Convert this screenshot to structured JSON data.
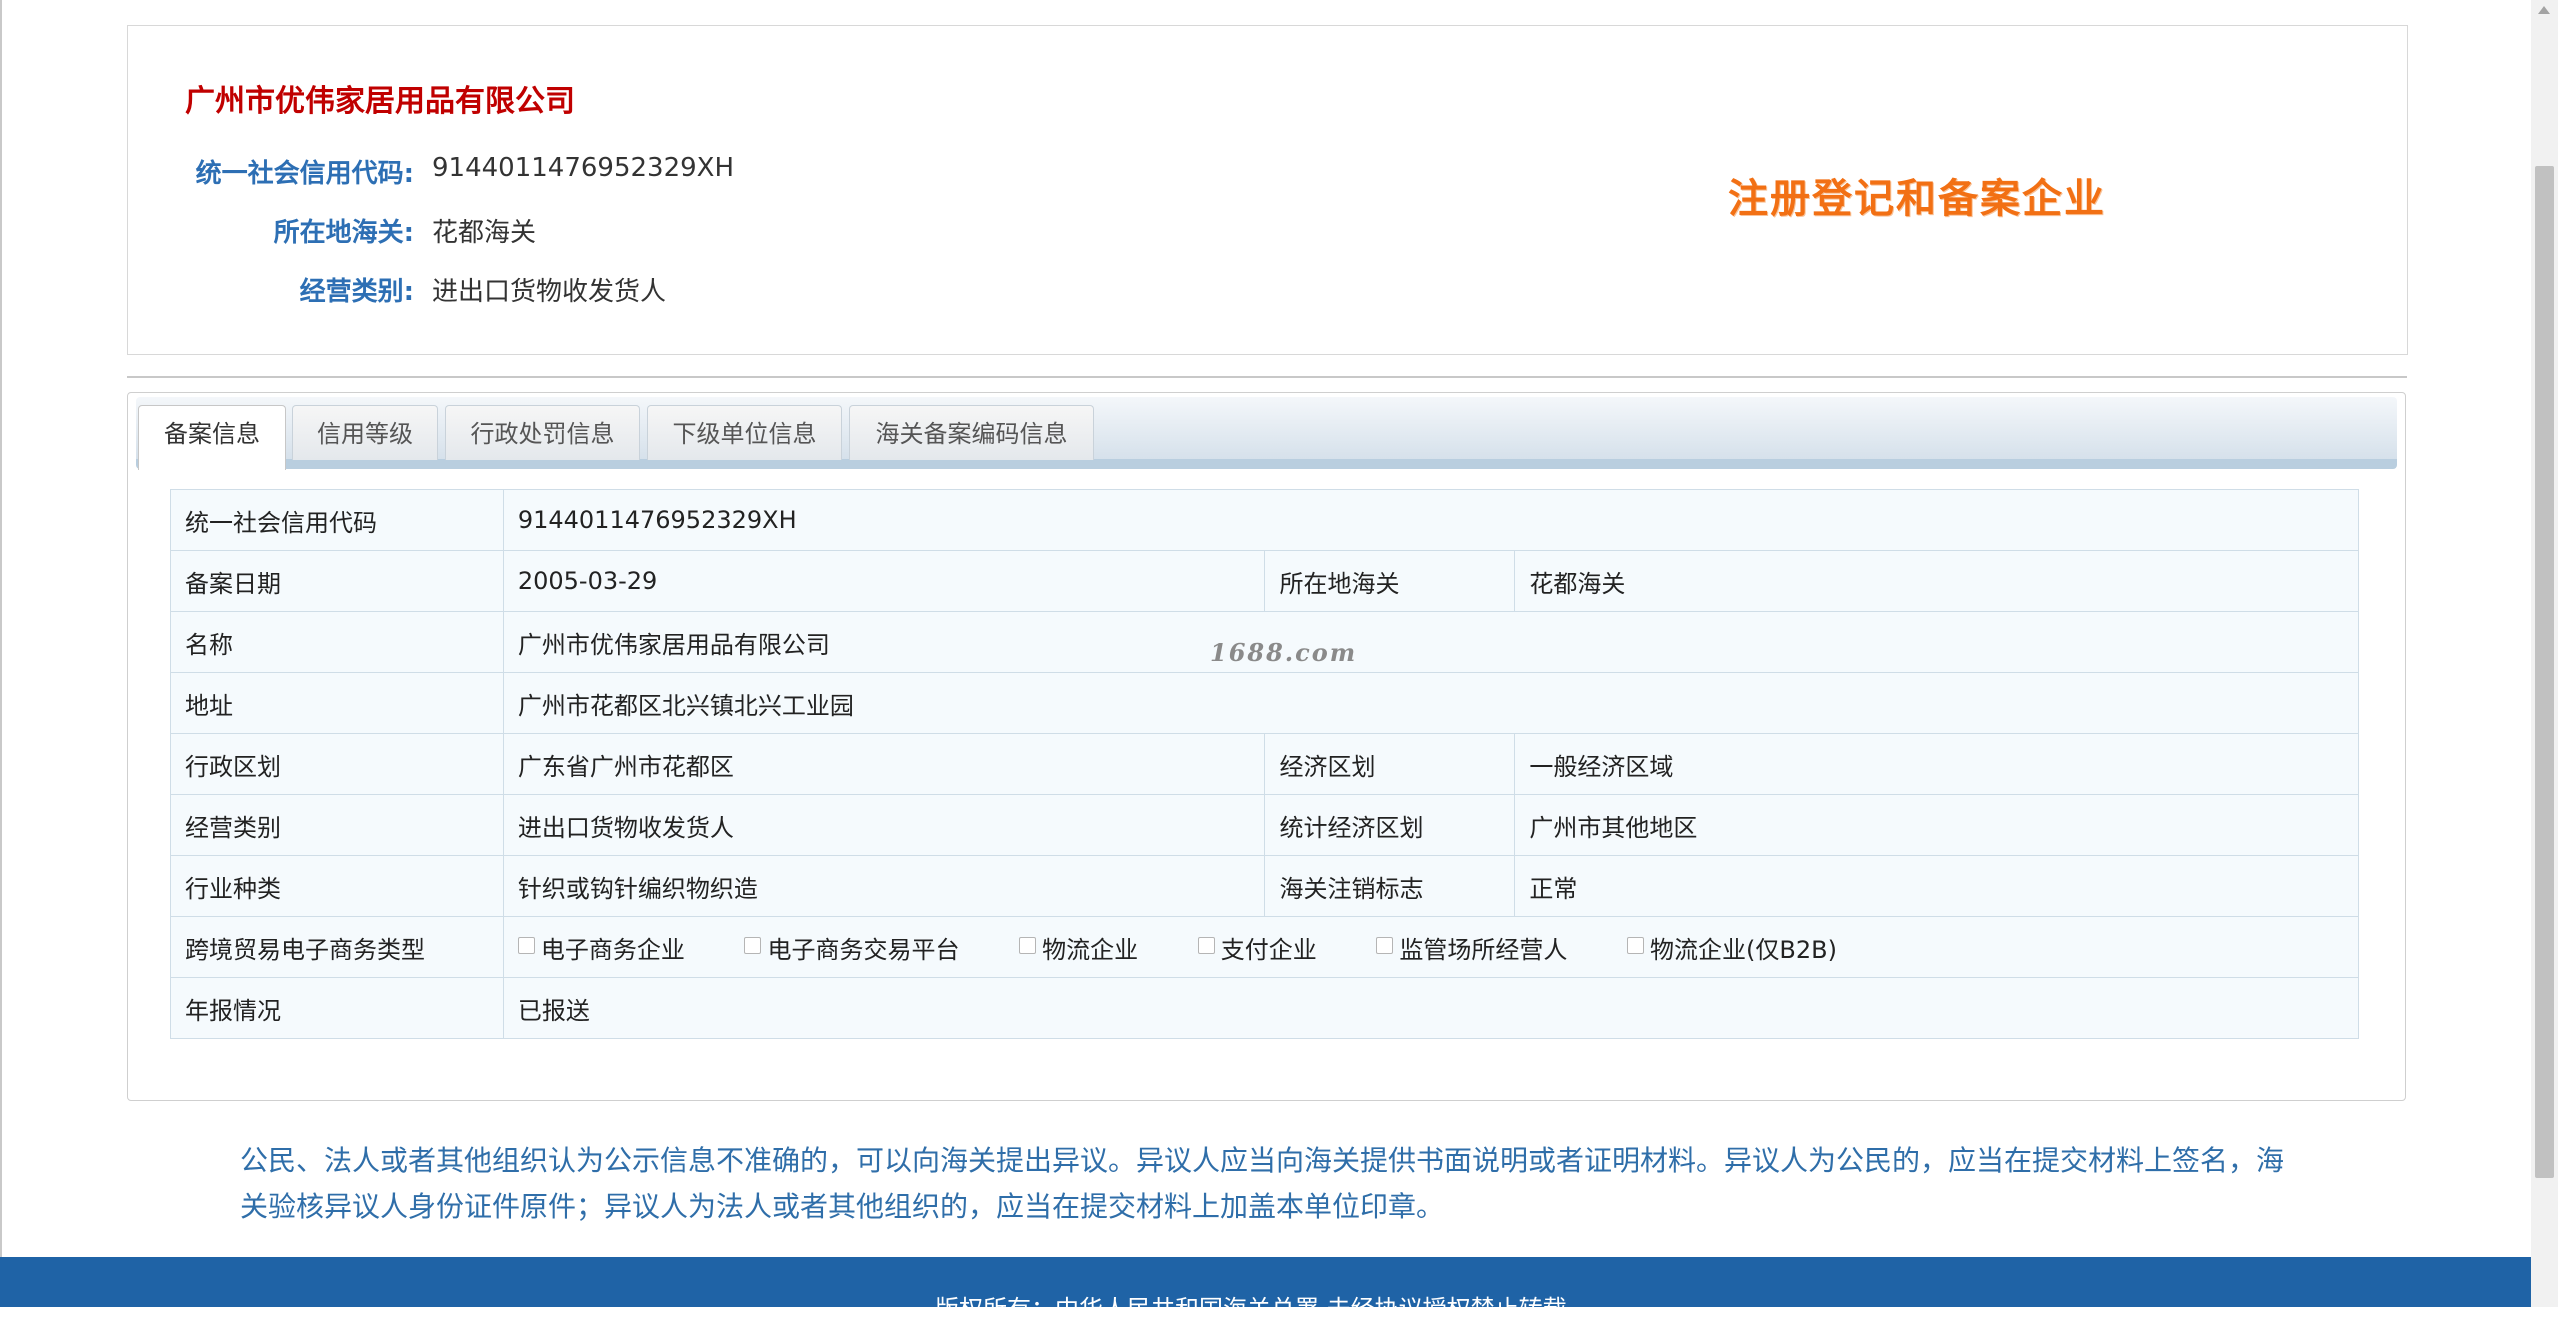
{
  "company": {
    "name": "广州市优伟家居用品有限公司",
    "fields": [
      {
        "label": "统一社会信用代码:",
        "value": "9144011476952329XH"
      },
      {
        "label": "所在地海关:",
        "value": "花都海关"
      },
      {
        "label": "经营类别:",
        "value": "进出口货物收发货人"
      }
    ],
    "stamp": "注册登记和备案企业"
  },
  "tabs": [
    {
      "label": "备案信息",
      "active": true
    },
    {
      "label": "信用等级",
      "active": false
    },
    {
      "label": "行政处罚信息",
      "active": false
    },
    {
      "label": "下级单位信息",
      "active": false
    },
    {
      "label": "海关备案编码信息",
      "active": false
    }
  ],
  "details": {
    "credit_code": {
      "label": "统一社会信用代码",
      "value": "9144011476952329XH"
    },
    "record_date": {
      "label": "备案日期",
      "value": "2005-03-29"
    },
    "customs": {
      "label": "所在地海关",
      "value": "花都海关"
    },
    "name": {
      "label": "名称",
      "value": "广州市优伟家居用品有限公司"
    },
    "address": {
      "label": "地址",
      "value": "广州市花都区北兴镇北兴工业园"
    },
    "admin_region": {
      "label": "行政区划",
      "value": "广东省广州市花都区"
    },
    "econ_region": {
      "label": "经济区划",
      "value": "一般经济区域"
    },
    "business_type": {
      "label": "经营类别",
      "value": "进出口货物收发货人"
    },
    "stat_region": {
      "label": "统计经济区划",
      "value": "广州市其他地区"
    },
    "industry": {
      "label": "行业种类",
      "value": "针织或钩针编织物织造"
    },
    "cancel_flag": {
      "label": "海关注销标志",
      "value": "正常"
    },
    "ecommerce": {
      "label": "跨境贸易电子商务类型",
      "options": [
        "电子商务企业",
        "电子商务交易平台",
        "物流企业",
        "支付企业",
        "监管场所经营人",
        "物流企业(仅B2B)"
      ]
    },
    "annual_report": {
      "label": "年报情况",
      "value": "已报送"
    }
  },
  "watermark": "1688.com",
  "notice": "公民、法人或者其他组织认为公示信息不准确的，可以向海关提出异议。异议人应当向海关提供书面说明或者证明材料。异议人为公民的，应当在提交材料上签名，海关验核异议人身份证件原件；异议人为法人或者其他组织的，应当在提交材料上加盖本单位印章。",
  "footer": "版权所有：中华人民共和国海关总署  未经协议授权禁止转载",
  "colors": {
    "accent": "#2d6fb4",
    "company_name": "#c00000",
    "stamp": "#f27014",
    "footer_bg": "#1f63a6"
  }
}
